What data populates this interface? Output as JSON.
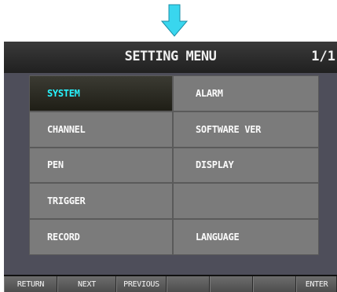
{
  "header": {
    "title": "SETTING MENU",
    "page": "1/1"
  },
  "menu": {
    "items": [
      {
        "label": "SYSTEM",
        "selected": true
      },
      {
        "label": "ALARM"
      },
      {
        "label": "CHANNEL"
      },
      {
        "label": "SOFTWARE VER"
      },
      {
        "label": "PEN"
      },
      {
        "label": "DISPLAY"
      },
      {
        "label": "TRIGGER"
      },
      {
        "label": ""
      },
      {
        "label": "RECORD"
      },
      {
        "label": "LANGUAGE"
      }
    ]
  },
  "softkeys": {
    "return": "RETURN",
    "next": "NEXT",
    "previous": "PREVIOUS",
    "blank1": "",
    "blank2": "",
    "blank3": "",
    "enter": "ENTER"
  },
  "colors": {
    "selected_text": "#27f4ff",
    "arrow": "#39d6ee"
  },
  "icons": {
    "pointer": "down-arrow-icon"
  }
}
